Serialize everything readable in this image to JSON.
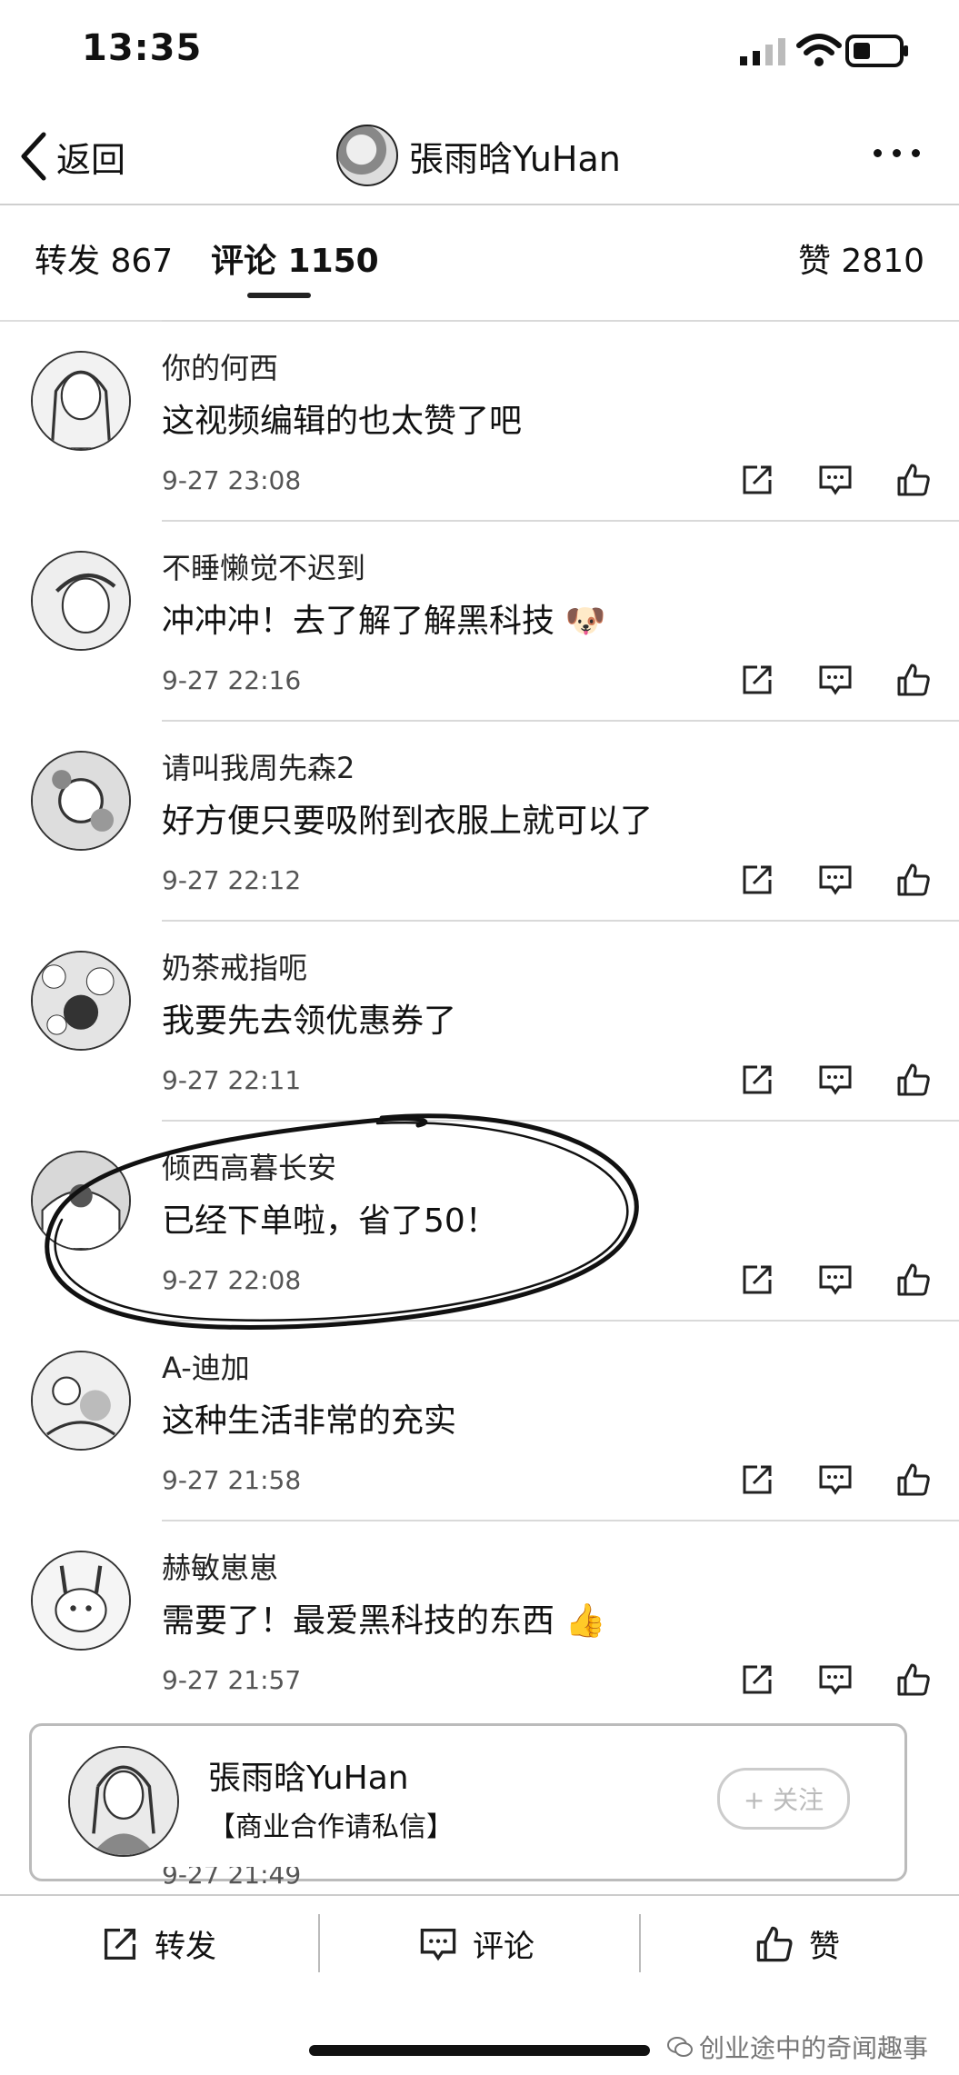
{
  "status_bar": {
    "time": "13:35"
  },
  "nav": {
    "back_label": "返回",
    "title": "張雨晗YuHan"
  },
  "tabs": {
    "repost": "转发 867",
    "comments": "评论 1150",
    "likes": "赞 2810"
  },
  "comments": [
    {
      "user": "你的何西",
      "text": "这视频编辑的也太赞了吧",
      "time": "9-27 23:08"
    },
    {
      "user": "不睡懒觉不迟到",
      "text": "冲冲冲！去了解了解黑科技",
      "time": "9-27 22:16"
    },
    {
      "user": "请叫我周先森2",
      "text": "好方便只要吸附到衣服上就可以了",
      "time": "9-27 22:12"
    },
    {
      "user": "奶茶戒指呃",
      "text": "我要先去领优惠券了",
      "time": "9-27 22:11"
    },
    {
      "user": "倾西高暮长安",
      "text": "已经下单啦，省了50！",
      "time": "9-27 22:08"
    },
    {
      "user": "A-迪加",
      "text": "这种生活非常的充实",
      "time": "9-27 21:58"
    },
    {
      "user": "赫敏崽崽",
      "text": "需要了！最爱黑科技的东西",
      "time": "9-27 21:57"
    }
  ],
  "author_card": {
    "name": "張雨晗YuHan",
    "bio": "【商业合作请私信】",
    "follow_label": "+ 关注"
  },
  "peek_time": "9-27 21:49",
  "bottom_bar": {
    "repost": "转发",
    "comment": "评论",
    "like": "赞"
  },
  "watermark": "创业途中的奇闻趣事",
  "icons": {
    "repost": "repost-icon",
    "comment": "comment-icon",
    "like": "thumbs-up-icon"
  }
}
